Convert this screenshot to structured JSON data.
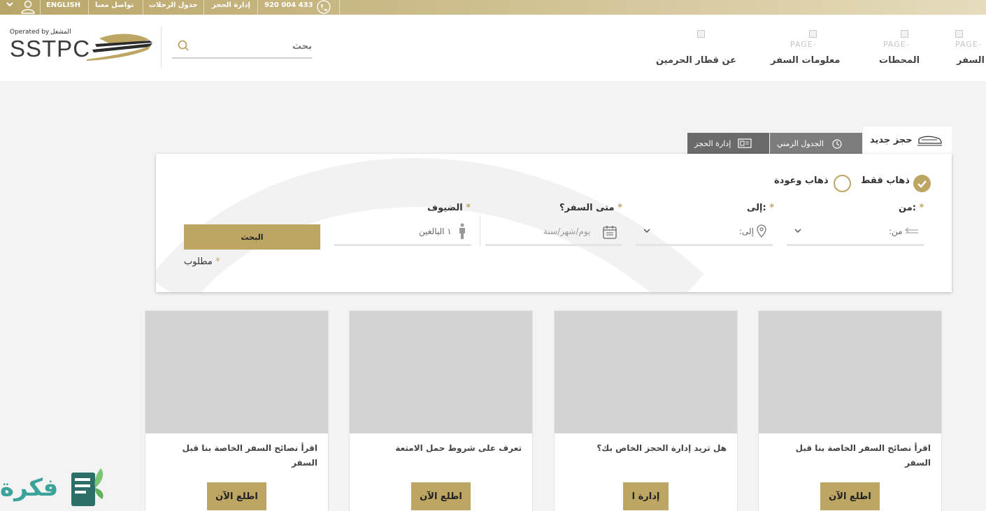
{
  "topbar": {
    "language": "ENGLISH",
    "contact": "تواصل معنا",
    "timetable": "جدول الرحلات",
    "manage": "إدارة الحجز",
    "phone": "920 004 433"
  },
  "header": {
    "nav": [
      {
        "label": "السفر",
        "image_alt": "PAGE-"
      },
      {
        "label": "المحطات",
        "image_alt": "PAGE-"
      },
      {
        "label": "معلومات السفر",
        "image_alt": "PAGE-"
      },
      {
        "label": "عن قطار الحرمين",
        "image_alt": ""
      }
    ],
    "search_placeholder": "بحث",
    "logo": {
      "operated_by": "Operated by",
      "operator_ar": "المشغل",
      "name": "SSTPC"
    }
  },
  "booking": {
    "tabs": {
      "new": "حجز جديد",
      "timetable": "الجدول الزمني",
      "manage": "إدارة الحجز"
    },
    "trip_type": {
      "one_way": "ذهاب فقط",
      "round_trip": "ذهاب وعودة",
      "selected": "one_way"
    },
    "fields": {
      "from_label": ":من",
      "from_placeholder": ":من",
      "to_label": ":إلى",
      "to_placeholder": ":إلى",
      "date_label": "متى السفر؟",
      "date_placeholder": "يوم/شهر/سنة",
      "guests_label": "الضيوف",
      "guests_value": "١ البالغين"
    },
    "search_button": "البحث",
    "required_note": "مطلوب",
    "accent_color": "#bda563"
  },
  "cards": [
    {
      "text": "اقرأ نصائح السفر الخاصة بنا قبل السفر",
      "button": "اطلع الآن"
    },
    {
      "text": "هل تريد إدارة الحجز الخاص بك؟",
      "button": "إدارة ا"
    },
    {
      "text": "تعرف على شروط حمل الامتعة",
      "button": "اطلع الآن"
    },
    {
      "text": "اقرأ نصائح السفر الخاصة بنا قبل السفر",
      "button": "اطلع الآن"
    }
  ],
  "watermark": {
    "text": "فكرة"
  }
}
